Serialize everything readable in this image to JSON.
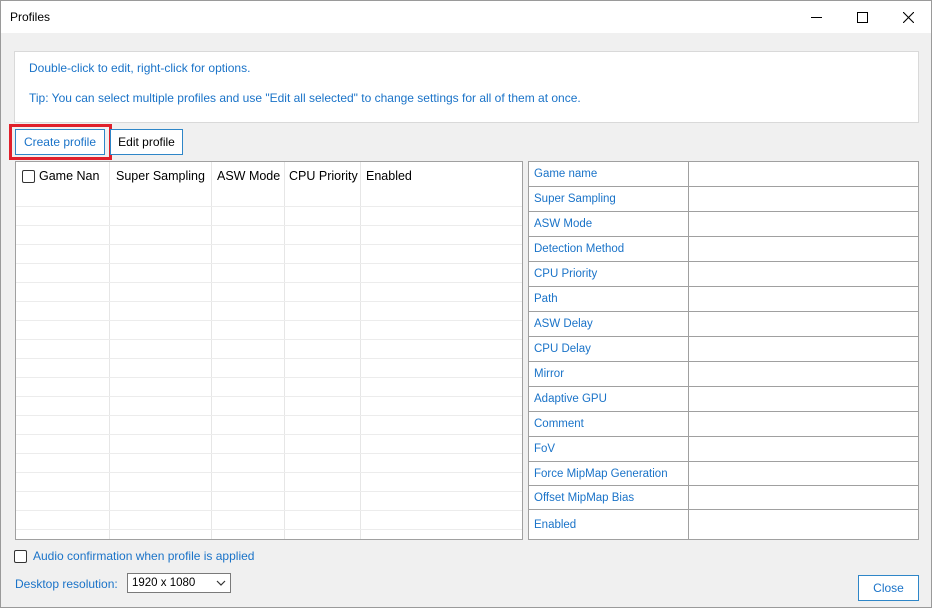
{
  "window": {
    "title": "Profiles",
    "controls": [
      "minimize-icon",
      "maximize-icon",
      "close-icon"
    ]
  },
  "info": {
    "line1": "Double-click to edit, right-click for options.",
    "line2": "Tip: You can select multiple profiles and use \"Edit all selected\" to change settings for all of them at once."
  },
  "toolbar": {
    "create_label": "Create profile",
    "edit_label": "Edit profile"
  },
  "grid": {
    "columns": [
      "Game Nan",
      "Super Sampling",
      "ASW Mode",
      "CPU Priority",
      "Enabled"
    ],
    "rows": []
  },
  "properties": [
    {
      "name": "Game name",
      "value": ""
    },
    {
      "name": "Super Sampling",
      "value": ""
    },
    {
      "name": "ASW Mode",
      "value": ""
    },
    {
      "name": "Detection Method",
      "value": ""
    },
    {
      "name": "CPU Priority",
      "value": ""
    },
    {
      "name": "Path",
      "value": ""
    },
    {
      "name": "ASW Delay",
      "value": ""
    },
    {
      "name": "CPU Delay",
      "value": ""
    },
    {
      "name": "Mirror",
      "value": ""
    },
    {
      "name": "Adaptive GPU",
      "value": ""
    },
    {
      "name": "Comment",
      "value": ""
    },
    {
      "name": "FoV",
      "value": ""
    },
    {
      "name": "Force MipMap Generation",
      "value": ""
    },
    {
      "name": "Offset MipMap Bias",
      "value": ""
    },
    {
      "name": "Enabled",
      "value": ""
    }
  ],
  "footer": {
    "audio_label": "Audio confirmation when profile is applied",
    "audio_checked": false,
    "resolution_label": "Desktop resolution:",
    "resolution_value": "1920 x 1080",
    "close_label": "Close"
  },
  "colors": {
    "accent_text": "#1a73c8",
    "highlight_border": "#e0202b"
  }
}
